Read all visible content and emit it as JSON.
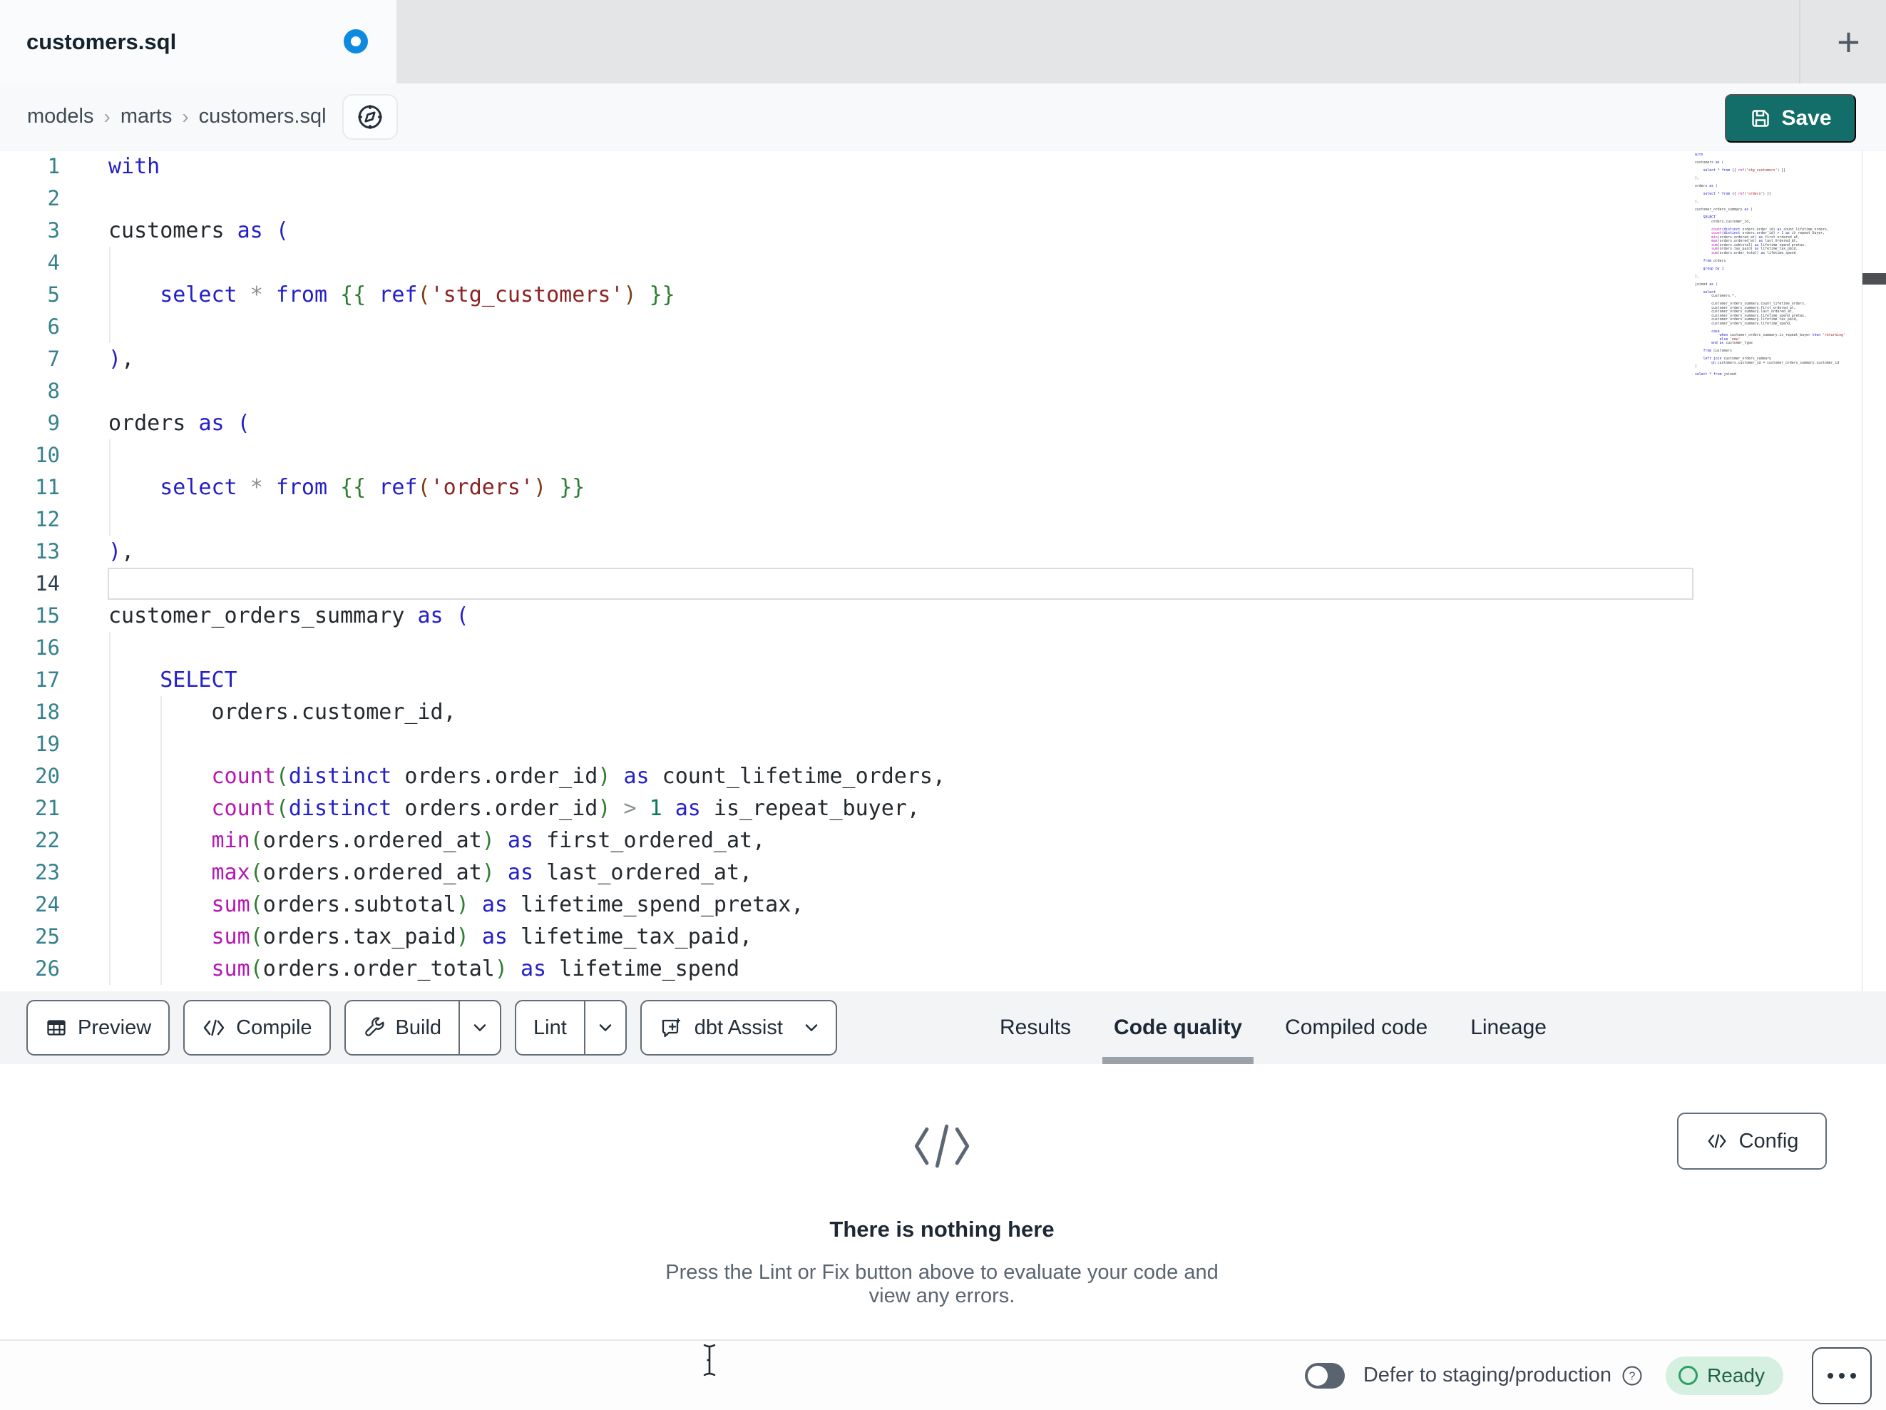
{
  "tab": {
    "title": "customers.sql"
  },
  "breadcrumb": {
    "items": [
      "models",
      "marts",
      "customers.sql"
    ],
    "separator": "›"
  },
  "actions": {
    "save": "Save",
    "config": "Config",
    "new_tab": "+"
  },
  "toolbar": {
    "preview": "Preview",
    "compile": "Compile",
    "build": "Build",
    "lint": "Lint",
    "dbt_assist": "dbt Assist"
  },
  "result_tabs": [
    {
      "label": "Results",
      "active": false
    },
    {
      "label": "Code quality",
      "active": true
    },
    {
      "label": "Compiled code",
      "active": false
    },
    {
      "label": "Lineage",
      "active": false
    }
  ],
  "empty_state": {
    "title": "There is nothing here",
    "subtitle": "Press the Lint or Fix button above to evaluate your code and view any errors."
  },
  "status_bar": {
    "defer_label": "Defer to staging/production",
    "ready": "Ready"
  },
  "colors": {
    "accent_teal": "#136e69",
    "unsaved_dot_blue": "#0d8be0",
    "ready_badge_bg": "#d5f0e1",
    "ready_green": "#2aa065",
    "keyword_blue": "#2420c8",
    "function_magenta": "#b517b5",
    "bracket_green": "#2e7d32",
    "string_maroon": "#8b2423"
  },
  "editor": {
    "active_line": 14,
    "lines": [
      {
        "n": 1,
        "toks": [
          [
            "kw",
            "with"
          ]
        ]
      },
      {
        "n": 2,
        "toks": []
      },
      {
        "n": 3,
        "toks": [
          [
            "id",
            "customers "
          ],
          [
            "kw",
            "as"
          ],
          [
            "id",
            " "
          ],
          [
            "p1",
            "("
          ]
        ]
      },
      {
        "n": 4,
        "toks": []
      },
      {
        "n": 5,
        "toks": [
          [
            "id",
            "    "
          ],
          [
            "kw",
            "select"
          ],
          [
            "id",
            " "
          ],
          [
            "op",
            "*"
          ],
          [
            "id",
            " "
          ],
          [
            "kw",
            "from"
          ],
          [
            "id",
            " "
          ],
          [
            "br",
            "{{"
          ],
          [
            "id",
            " "
          ],
          [
            "kw",
            "ref"
          ],
          [
            "pn",
            "("
          ],
          [
            "str",
            "'stg_customers'"
          ],
          [
            "pn",
            ")"
          ],
          [
            "id",
            " "
          ],
          [
            "br",
            "}}"
          ]
        ]
      },
      {
        "n": 6,
        "toks": []
      },
      {
        "n": 7,
        "toks": [
          [
            "p1",
            ")"
          ],
          [
            "id",
            ","
          ]
        ]
      },
      {
        "n": 8,
        "toks": []
      },
      {
        "n": 9,
        "toks": [
          [
            "id",
            "orders "
          ],
          [
            "kw",
            "as"
          ],
          [
            "id",
            " "
          ],
          [
            "p1",
            "("
          ]
        ]
      },
      {
        "n": 10,
        "toks": []
      },
      {
        "n": 11,
        "toks": [
          [
            "id",
            "    "
          ],
          [
            "kw",
            "select"
          ],
          [
            "id",
            " "
          ],
          [
            "op",
            "*"
          ],
          [
            "id",
            " "
          ],
          [
            "kw",
            "from"
          ],
          [
            "id",
            " "
          ],
          [
            "br",
            "{{"
          ],
          [
            "id",
            " "
          ],
          [
            "kw",
            "ref"
          ],
          [
            "pn",
            "("
          ],
          [
            "str",
            "'orders'"
          ],
          [
            "pn",
            ")"
          ],
          [
            "id",
            " "
          ],
          [
            "br",
            "}}"
          ]
        ]
      },
      {
        "n": 12,
        "toks": []
      },
      {
        "n": 13,
        "toks": [
          [
            "p1",
            ")"
          ],
          [
            "id",
            ","
          ]
        ]
      },
      {
        "n": 14,
        "toks": []
      },
      {
        "n": 15,
        "toks": [
          [
            "id",
            "customer_orders_summary "
          ],
          [
            "kw",
            "as"
          ],
          [
            "id",
            " "
          ],
          [
            "p1",
            "("
          ]
        ]
      },
      {
        "n": 16,
        "toks": []
      },
      {
        "n": 17,
        "toks": [
          [
            "id",
            "    "
          ],
          [
            "kw",
            "SELECT"
          ]
        ]
      },
      {
        "n": 18,
        "toks": [
          [
            "id",
            "        orders.customer_id,"
          ]
        ]
      },
      {
        "n": 19,
        "toks": []
      },
      {
        "n": 20,
        "toks": [
          [
            "id",
            "        "
          ],
          [
            "fn",
            "count"
          ],
          [
            "br",
            "("
          ],
          [
            "kw",
            "distinct"
          ],
          [
            "id",
            " orders.order_id"
          ],
          [
            "br",
            ")"
          ],
          [
            "id",
            " "
          ],
          [
            "kw",
            "as"
          ],
          [
            "id",
            " count_lifetime_orders,"
          ]
        ]
      },
      {
        "n": 21,
        "toks": [
          [
            "id",
            "        "
          ],
          [
            "fn",
            "count"
          ],
          [
            "br",
            "("
          ],
          [
            "kw",
            "distinct"
          ],
          [
            "id",
            " orders.order_id"
          ],
          [
            "br",
            ")"
          ],
          [
            "id",
            " "
          ],
          [
            "op",
            ">"
          ],
          [
            "id",
            " "
          ],
          [
            "num",
            "1"
          ],
          [
            "id",
            " "
          ],
          [
            "kw",
            "as"
          ],
          [
            "id",
            " is_repeat_buyer,"
          ]
        ]
      },
      {
        "n": 22,
        "toks": [
          [
            "id",
            "        "
          ],
          [
            "fn",
            "min"
          ],
          [
            "br",
            "("
          ],
          [
            "id",
            "orders.ordered_at"
          ],
          [
            "br",
            ")"
          ],
          [
            "id",
            " "
          ],
          [
            "kw",
            "as"
          ],
          [
            "id",
            " first_ordered_at,"
          ]
        ]
      },
      {
        "n": 23,
        "toks": [
          [
            "id",
            "        "
          ],
          [
            "fn",
            "max"
          ],
          [
            "br",
            "("
          ],
          [
            "id",
            "orders.ordered_at"
          ],
          [
            "br",
            ")"
          ],
          [
            "id",
            " "
          ],
          [
            "kw",
            "as"
          ],
          [
            "id",
            " last_ordered_at,"
          ]
        ]
      },
      {
        "n": 24,
        "toks": [
          [
            "id",
            "        "
          ],
          [
            "fn",
            "sum"
          ],
          [
            "br",
            "("
          ],
          [
            "id",
            "orders.subtotal"
          ],
          [
            "br",
            ")"
          ],
          [
            "id",
            " "
          ],
          [
            "kw",
            "as"
          ],
          [
            "id",
            " lifetime_spend_pretax,"
          ]
        ]
      },
      {
        "n": 25,
        "toks": [
          [
            "id",
            "        "
          ],
          [
            "fn",
            "sum"
          ],
          [
            "br",
            "("
          ],
          [
            "id",
            "orders.tax_paid"
          ],
          [
            "br",
            ")"
          ],
          [
            "id",
            " "
          ],
          [
            "kw",
            "as"
          ],
          [
            "id",
            " lifetime_tax_paid,"
          ]
        ]
      },
      {
        "n": 26,
        "toks": [
          [
            "id",
            "        "
          ],
          [
            "fn",
            "sum"
          ],
          [
            "br",
            "("
          ],
          [
            "id",
            "orders.order_total"
          ],
          [
            "br",
            ")"
          ],
          [
            "id",
            " "
          ],
          [
            "kw",
            "as"
          ],
          [
            "id",
            " lifetime_spend"
          ]
        ]
      }
    ]
  },
  "minimap_code": "with\n\ncustomers as (\n\n    select * from {{ ref('stg_customers') }}\n\n),\n\norders as (\n\n    select * from {{ ref('orders') }}\n\n),\n\ncustomer_orders_summary as (\n\n    SELECT\n        orders.customer_id,\n\n        count(distinct orders.order_id) as count_lifetime_orders,\n        count(distinct orders.order_id) > 1 as is_repeat_buyer,\n        min(orders.ordered_at) as first_ordered_at,\n        max(orders.ordered_at) as last_ordered_at,\n        sum(orders.subtotal) as lifetime_spend_pretax,\n        sum(orders.tax_paid) as lifetime_tax_paid,\n        sum(orders.order_total) as lifetime_spend\n\n    from orders\n\n    group by 1\n\n),\n\njoined as (\n\n    select\n        customers.*,\n\n        customer_orders_summary.count_lifetime_orders,\n        customer_orders_summary.first_ordered_at,\n        customer_orders_summary.last_ordered_at,\n        customer_orders_summary.lifetime_spend_pretax,\n        customer_orders_summary.lifetime_tax_paid,\n        customer_orders_summary.lifetime_spend,\n\n        case\n            when customer_orders_summary.is_repeat_buyer then 'returning'\n            else 'new'\n        end as customer_type\n\n    from customers\n\n    left join customer_orders_summary\n        on customers.customer_id = customer_orders_summary.customer_id\n)\n\nselect * from joined"
}
